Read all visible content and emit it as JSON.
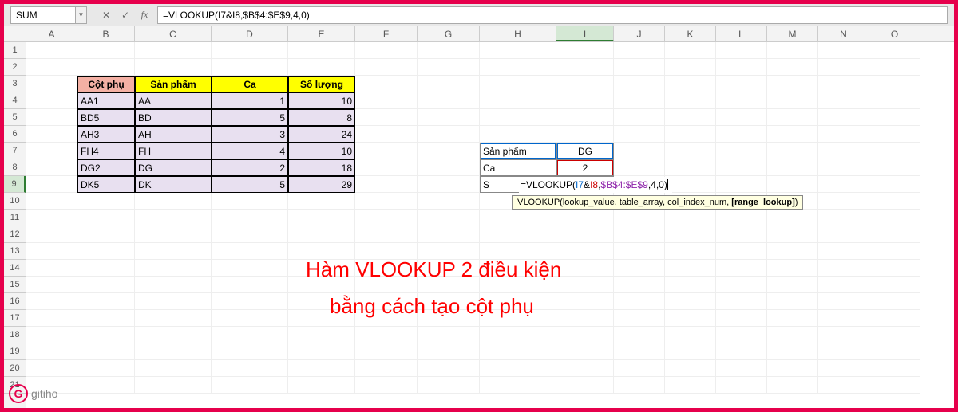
{
  "name_box": "SUM",
  "formula_display": "=VLOOKUP(I7&I8,$B$4:$E$9,4,0)",
  "columns": [
    "A",
    "B",
    "C",
    "D",
    "E",
    "F",
    "G",
    "H",
    "I",
    "J",
    "K",
    "L",
    "M",
    "N",
    "O"
  ],
  "rows": [
    "1",
    "2",
    "3",
    "4",
    "5",
    "6",
    "7",
    "8",
    "9",
    "10",
    "11",
    "12",
    "13",
    "14",
    "15",
    "16",
    "17",
    "18",
    "19",
    "20",
    "21"
  ],
  "table": {
    "headers": [
      "Cột phụ",
      "Sản phẩm",
      "Ca",
      "Số lượng"
    ],
    "data": [
      [
        "AA1",
        "AA",
        "1",
        "10"
      ],
      [
        "BD5",
        "BD",
        "5",
        "8"
      ],
      [
        "AH3",
        "AH",
        "3",
        "24"
      ],
      [
        "FH4",
        "FH",
        "4",
        "10"
      ],
      [
        "DG2",
        "DG",
        "2",
        "18"
      ],
      [
        "DK5",
        "DK",
        "5",
        "29"
      ]
    ]
  },
  "lookup": {
    "labels": [
      "Sản phẩm",
      "Ca",
      "S"
    ],
    "values": [
      "DG",
      "2"
    ]
  },
  "cell_formula": {
    "eq": "=VLOOKUP(",
    "a1": "I7",
    "amp": "&",
    "a2": "I8",
    "c1": ",",
    "rng": "$B$4:$E$9",
    "c2": ",",
    "idx": "4",
    "c3": ",",
    "rl": "0",
    "close": ")"
  },
  "tooltip": {
    "fn": "VLOOKUP(",
    "p1": "lookup_value",
    "p2": "table_array",
    "p3": "col_index_num",
    "p4": "[range_lookup]",
    "close": ")"
  },
  "annotation": {
    "line1": "Hàm VLOOKUP 2 điều kiện",
    "line2": "bằng cách tạo cột phụ"
  },
  "logo_text": "gitiho"
}
